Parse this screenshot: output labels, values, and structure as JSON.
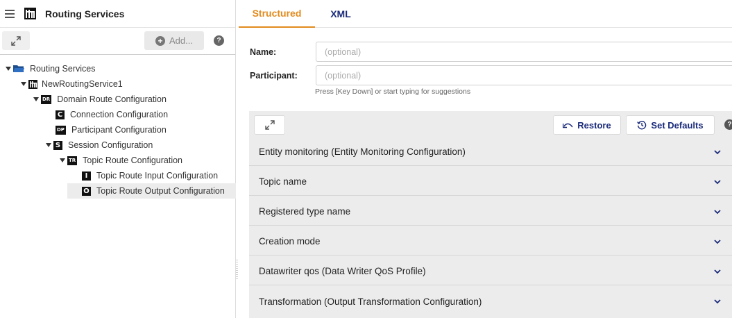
{
  "sidebar": {
    "title": "Routing Services",
    "add_label": "Add...",
    "help_label": "?"
  },
  "tree": {
    "items": [
      {
        "label": "Routing Services",
        "icon": "folder-open-icon"
      },
      {
        "label": "NewRoutingService1",
        "icon": "routing-service-icon"
      },
      {
        "label": "Domain Route Configuration",
        "badge": "DR"
      },
      {
        "label": "Connection Configuration",
        "badge": "C"
      },
      {
        "label": "Participant Configuration",
        "badge": "DP"
      },
      {
        "label": "Session Configuration",
        "badge": "S"
      },
      {
        "label": "Topic Route Configuration",
        "badge": "TR"
      },
      {
        "label": "Topic Route Input Configuration",
        "badge": "I"
      },
      {
        "label": "Topic Route Output Configuration",
        "badge": "O",
        "selected": true
      }
    ]
  },
  "tabs": {
    "structured": "Structured",
    "xml": "XML"
  },
  "form": {
    "name_label": "Name:",
    "name_placeholder": "(optional)",
    "participant_label": "Participant:",
    "participant_placeholder": "(optional)",
    "hint": "Press [Key Down] or start typing for suggestions"
  },
  "toolbar": {
    "restore_label": "Restore",
    "set_defaults_label": "Set Defaults",
    "help_label": "?"
  },
  "sections": [
    "Entity monitoring (Entity Monitoring Configuration)",
    "Topic name",
    "Registered type name",
    "Creation mode",
    "Datawriter qos (Data Writer QoS Profile)",
    "Transformation (Output Transformation Configuration)"
  ],
  "colors": {
    "accent_orange": "#e28a1d",
    "link_navy": "#1a2a7a",
    "panel_gray": "#ececec"
  }
}
